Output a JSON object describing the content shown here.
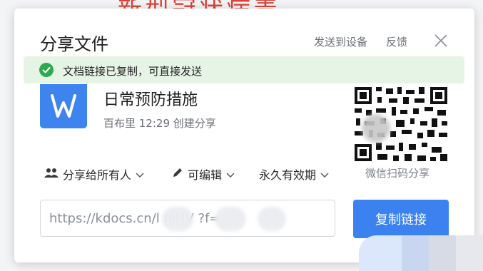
{
  "background": {
    "heading": "新型冠状病毒"
  },
  "dialog": {
    "title": "分享文件",
    "send_to_device": "发送到设备",
    "feedback": "反馈",
    "close_icon": "close-icon"
  },
  "toast": {
    "icon": "check-circle-icon",
    "message": "文档链接已复制，可直接发送"
  },
  "file": {
    "icon": "wps-writer-icon",
    "name": "日常预防措施",
    "meta": "百布里 12:29 创建分享"
  },
  "options": {
    "share_scope": "分享给所有人",
    "permission": "可编辑",
    "expiry": "永久有效期"
  },
  "qr": {
    "label": "微信扫码分享"
  },
  "link": {
    "url": "https://kdocs.cn/l    niHV    ?f="
  },
  "copy_button": {
    "label": "复制链接"
  },
  "colors": {
    "accent": "#3b82f0",
    "toast_bg": "#e6f4e6",
    "success": "#2fa84f",
    "file_icon": "#3e84ee"
  }
}
